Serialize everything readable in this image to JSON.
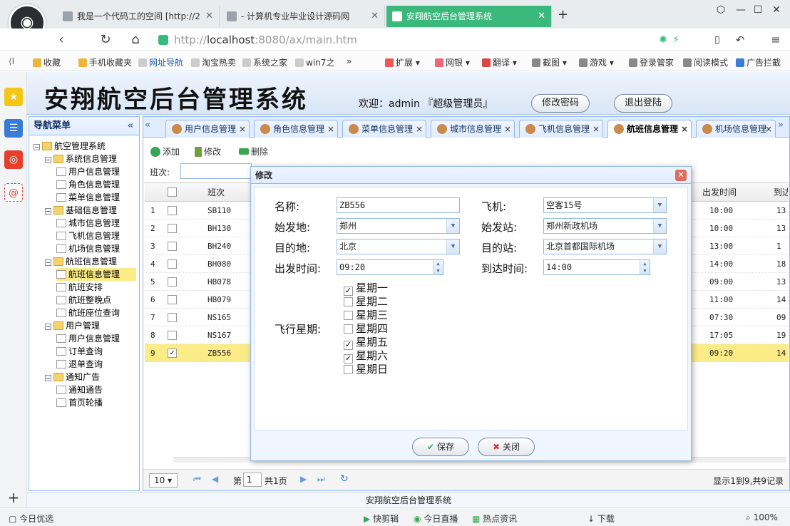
{
  "browser": {
    "tabs": [
      {
        "title": "我是一个代码工的空间 [http://2"
      },
      {
        "title": "- 计算机专业毕业设计源码网"
      },
      {
        "title": "安翔航空后台管理系统"
      }
    ],
    "new_tab": "+",
    "url_scheme": "http://",
    "url_host": "localhost",
    "url_rest": ":8080/ax/main.htm",
    "bookmarks": [
      "收藏",
      "手机收藏夹",
      "网址导航",
      "淘宝热卖",
      "系统之家",
      "win7之"
    ],
    "extensions": [
      "扩展",
      "网银",
      "翻译",
      "截图",
      "游戏",
      "登录管家",
      "阅读模式",
      "广告拦截"
    ],
    "status": [
      "今日优选",
      "快剪辑",
      "今日直播",
      "热点资讯",
      "下载",
      "100%"
    ]
  },
  "header": {
    "title": "安翔航空后台管理系统",
    "welcome": "欢迎：admin 『超级管理员』",
    "change_password": "修改密码",
    "logout": "退出登陆"
  },
  "nav": {
    "title": "导航菜单",
    "collapse": "«",
    "tree": [
      {
        "label": "航空管理系统",
        "level": 0,
        "type": "folder"
      },
      {
        "label": "系统信息管理",
        "level": 1,
        "type": "folder"
      },
      {
        "label": "用户信息管理",
        "level": 2,
        "type": "file"
      },
      {
        "label": "角色信息管理",
        "level": 2,
        "type": "file"
      },
      {
        "label": "菜单信息管理",
        "level": 2,
        "type": "file"
      },
      {
        "label": "基础信息管理",
        "level": 1,
        "type": "folder"
      },
      {
        "label": "城市信息管理",
        "level": 2,
        "type": "file"
      },
      {
        "label": "飞机信息管理",
        "level": 2,
        "type": "file"
      },
      {
        "label": "机场信息管理",
        "level": 2,
        "type": "file"
      },
      {
        "label": "航班信息管理",
        "level": 1,
        "type": "folder"
      },
      {
        "label": "航班信息管理",
        "level": 2,
        "type": "file",
        "selected": true
      },
      {
        "label": "航班安排",
        "level": 2,
        "type": "file"
      },
      {
        "label": "航班整晚点",
        "level": 2,
        "type": "file"
      },
      {
        "label": "航班座位查询",
        "level": 2,
        "type": "file"
      },
      {
        "label": "用户管理",
        "level": 1,
        "type": "folder"
      },
      {
        "label": "用户信息管理",
        "level": 2,
        "type": "file"
      },
      {
        "label": "订单查询",
        "level": 2,
        "type": "file"
      },
      {
        "label": "退单查询",
        "level": 2,
        "type": "file"
      },
      {
        "label": "通知广告",
        "level": 1,
        "type": "folder"
      },
      {
        "label": "通知通告",
        "level": 2,
        "type": "file"
      },
      {
        "label": "首页轮播",
        "level": 2,
        "type": "file"
      }
    ]
  },
  "tabs": [
    {
      "label": "用户信息管理"
    },
    {
      "label": "角色信息管理"
    },
    {
      "label": "菜单信息管理"
    },
    {
      "label": "城市信息管理"
    },
    {
      "label": "飞机信息管理"
    },
    {
      "label": "航班信息管理",
      "active": true
    },
    {
      "label": "机场信息管理"
    }
  ],
  "toolbar": {
    "add": "添加",
    "edit": "修改",
    "delete": "删除"
  },
  "search": {
    "label": "班次:"
  },
  "grid": {
    "columns": {
      "flight": "班次",
      "depart": "出发时间",
      "arrive": "到达"
    },
    "rows": [
      {
        "no": "1",
        "flight": "SB110",
        "depart": "10:00",
        "arrive": "13"
      },
      {
        "no": "2",
        "flight": "BH130",
        "depart": "10:00",
        "arrive": "13"
      },
      {
        "no": "3",
        "flight": "BH240",
        "depart": "13:00",
        "arrive": "1"
      },
      {
        "no": "4",
        "flight": "BH080",
        "depart": "14:00",
        "arrive": "18"
      },
      {
        "no": "5",
        "flight": "HB078",
        "depart": "09:00",
        "arrive": "13"
      },
      {
        "no": "6",
        "flight": "HB079",
        "depart": "11:00",
        "arrive": "14"
      },
      {
        "no": "7",
        "flight": "NS165",
        "depart": "07:30",
        "arrive": "09"
      },
      {
        "no": "8",
        "flight": "NS167",
        "depart": "17:05",
        "arrive": "19"
      },
      {
        "no": "9",
        "flight": "ZB556",
        "depart": "09:20",
        "arrive": "14",
        "selected": true
      }
    ]
  },
  "pager": {
    "page_size": "10",
    "page_label": "第",
    "page": "1",
    "total_pages": "共1页",
    "summary": "显示1到9,共9记录"
  },
  "footer": "安翔航空后台管理系统",
  "dialog": {
    "title": "修改",
    "name_label": "名称:",
    "name": "ZB556",
    "plane_label": "飞机:",
    "plane": "空客15号",
    "from_city_label": "始发地:",
    "from_city": "郑州",
    "from_station_label": "始发站:",
    "from_station": "郑州新政机场",
    "to_city_label": "目的地:",
    "to_city": "北京",
    "to_station_label": "目的站:",
    "to_station": "北京首都国际机场",
    "depart_label": "出发时间:",
    "depart": "09:20",
    "arrive_label": "到达时间:",
    "arrive": "14:00",
    "weekdays_label": "飞行星期:",
    "weekdays": [
      {
        "label": "星期一",
        "checked": true
      },
      {
        "label": "星期二",
        "checked": false
      },
      {
        "label": "星期三",
        "checked": false
      },
      {
        "label": "星期四",
        "checked": false
      },
      {
        "label": "星期五",
        "checked": true
      },
      {
        "label": "星期六",
        "checked": true
      },
      {
        "label": "星期日",
        "checked": false
      }
    ],
    "save": "保存",
    "close": "关闭"
  },
  "colors": {
    "active_tab": "#3bb97c",
    "panel_border": "#95b8e7",
    "selected_row": "#fbec88"
  }
}
